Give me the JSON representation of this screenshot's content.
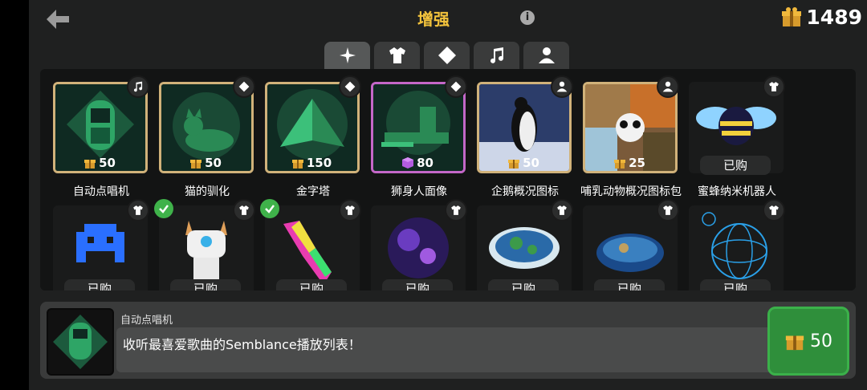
{
  "header": {
    "title": "增强",
    "info_icon": "info-icon",
    "currency_value": "1489"
  },
  "tabs": [
    {
      "name": "sparkle-icon"
    },
    {
      "name": "shirt-icon"
    },
    {
      "name": "diamond-icon"
    },
    {
      "name": "music-note-icon"
    },
    {
      "name": "person-icon"
    }
  ],
  "row1": [
    {
      "caption": "自动点唱机",
      "price": "50",
      "badge": "music-note-icon"
    },
    {
      "caption": "猫的驯化",
      "price": "50",
      "badge": "diamond-icon"
    },
    {
      "caption": "金字塔",
      "price": "150",
      "badge": "diamond-icon"
    },
    {
      "caption": "狮身人面像",
      "price": "80",
      "badge": "diamond-icon"
    },
    {
      "caption": "企鹅概况图标",
      "price": "50",
      "badge": "person-icon"
    },
    {
      "caption": "哺乳动物概况图标包",
      "price": "25",
      "badge": "person-icon"
    },
    {
      "caption": "蜜蜂纳米机器人",
      "bought": "已购",
      "badge": "shirt-icon"
    }
  ],
  "row2": [
    {
      "bought": "已购",
      "badge": "shirt-icon"
    },
    {
      "bought": "已购",
      "badge": "shirt-icon"
    },
    {
      "bought": "已购",
      "badge": "shirt-icon"
    },
    {
      "bought": "已购",
      "badge": "shirt-icon"
    },
    {
      "bought": "已购",
      "badge": "shirt-icon"
    },
    {
      "bought": "已购",
      "badge": "shirt-icon"
    },
    {
      "bought": "已购",
      "badge": "shirt-icon"
    }
  ],
  "detail": {
    "title": "自动点唱机",
    "description": "收听最喜爱歌曲的Semblance播放列表！",
    "buy_price": "50"
  },
  "colors": {
    "gold": "#f3c33c",
    "buy_green": "#2f8f3b",
    "frame_gold": "#d1b27a",
    "frame_pink": "#c467c8"
  }
}
